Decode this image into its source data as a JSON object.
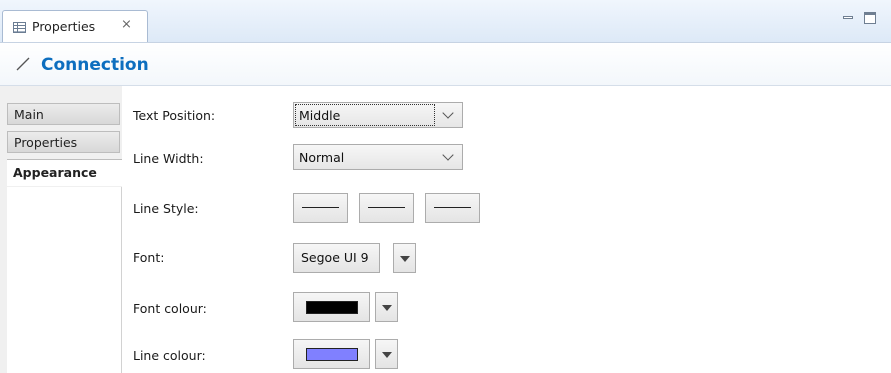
{
  "view_tab": {
    "label": "Properties",
    "close_glyph": "⨯"
  },
  "title": {
    "text": "Connection",
    "icon": "connection-line-icon"
  },
  "side_tabs": [
    {
      "label": "Main",
      "active": false
    },
    {
      "label": "Properties",
      "active": false
    },
    {
      "label": "Appearance",
      "active": true
    }
  ],
  "properties": {
    "text_position": {
      "label": "Text Position:",
      "value": "Middle"
    },
    "line_width": {
      "label": "Line Width:",
      "value": "Normal"
    },
    "line_style": {
      "label": "Line Style:"
    },
    "font": {
      "label": "Font:",
      "value": "Segoe UI 9"
    },
    "font_colour": {
      "label": "Font colour:",
      "color": "#000000"
    },
    "line_colour": {
      "label": "Line colour:",
      "color": "#8080ff"
    }
  },
  "colors": {
    "title_accent": "#0d6ebf",
    "tab_bar_bg": "#dde9f7"
  }
}
